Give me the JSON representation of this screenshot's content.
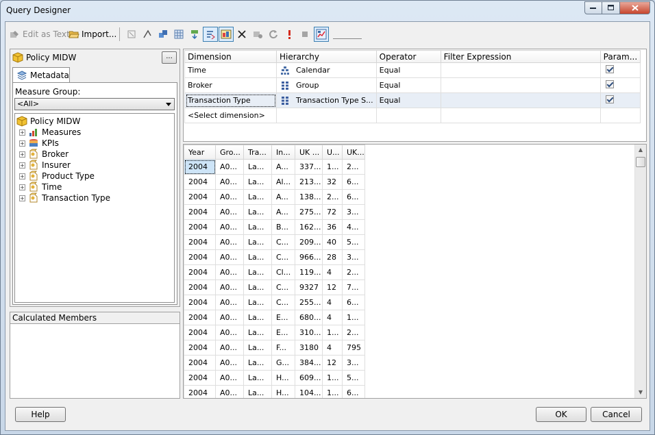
{
  "window": {
    "title": "Query Designer"
  },
  "toolbar": {
    "edit_as_text": "Edit as Text",
    "import": "Import..."
  },
  "cube": {
    "name": "Policy MIDW",
    "browse_button": "..."
  },
  "metadata_tab": {
    "label": "Metadata"
  },
  "measure_group": {
    "label": "Measure Group:",
    "value": "<All>"
  },
  "tree": {
    "root": "Policy MIDW",
    "items": [
      {
        "label": "Measures",
        "icon": "measures-icon"
      },
      {
        "label": "KPIs",
        "icon": "kpi-icon"
      },
      {
        "label": "Broker",
        "icon": "dimension-icon"
      },
      {
        "label": "Insurer",
        "icon": "dimension-icon"
      },
      {
        "label": "Product Type",
        "icon": "dimension-icon"
      },
      {
        "label": "Time",
        "icon": "dimension-icon"
      },
      {
        "label": "Transaction Type",
        "icon": "dimension-icon"
      }
    ]
  },
  "calculated_members": {
    "label": "Calculated Members"
  },
  "filter": {
    "headers": [
      "Dimension",
      "Hierarchy",
      "Operator",
      "Filter Expression",
      "Param..."
    ],
    "rows": [
      {
        "dimension": "Time",
        "hierarchy": "Calendar",
        "operator": "Equal",
        "expression": "",
        "param": true,
        "icon": "hierarchy-icon"
      },
      {
        "dimension": "Broker",
        "hierarchy": "Group",
        "operator": "Equal",
        "expression": "",
        "param": true,
        "icon": "attribute-icon"
      },
      {
        "dimension": "Transaction Type",
        "hierarchy": "Transaction Type S...",
        "operator": "Equal",
        "expression": "",
        "param": true,
        "icon": "attribute-icon"
      }
    ],
    "select_dimension": "<Select dimension>"
  },
  "results": {
    "headers": [
      "Year",
      "Gro...",
      "Tra...",
      "In...",
      "UK ...",
      "U...",
      "UK..."
    ],
    "rows": [
      [
        "2004",
        "A0...",
        "La...",
        "A...",
        "337...",
        "1...",
        "2..."
      ],
      [
        "2004",
        "A0...",
        "La...",
        "Al...",
        "213...",
        "32",
        "6..."
      ],
      [
        "2004",
        "A0...",
        "La...",
        "A...",
        "138...",
        "2...",
        "6..."
      ],
      [
        "2004",
        "A0...",
        "La...",
        "A...",
        "275...",
        "72",
        "3..."
      ],
      [
        "2004",
        "A0...",
        "La...",
        "B...",
        "162...",
        "36",
        "4..."
      ],
      [
        "2004",
        "A0...",
        "La...",
        "C...",
        "209...",
        "40",
        "5..."
      ],
      [
        "2004",
        "A0...",
        "La...",
        "C...",
        "966...",
        "28",
        "3..."
      ],
      [
        "2004",
        "A0...",
        "La...",
        "Cl...",
        "119...",
        "4",
        "2..."
      ],
      [
        "2004",
        "A0...",
        "La...",
        "C...",
        "9327",
        "12",
        "7..."
      ],
      [
        "2004",
        "A0...",
        "La...",
        "C...",
        "255...",
        "4",
        "6..."
      ],
      [
        "2004",
        "A0...",
        "La...",
        "E...",
        "680...",
        "4",
        "1..."
      ],
      [
        "2004",
        "A0...",
        "La...",
        "E...",
        "310...",
        "1...",
        "2..."
      ],
      [
        "2004",
        "A0...",
        "La...",
        "F...",
        "3180",
        "4",
        "795"
      ],
      [
        "2004",
        "A0...",
        "La...",
        "G...",
        "384...",
        "12",
        "3..."
      ],
      [
        "2004",
        "A0...",
        "La...",
        "H...",
        "609...",
        "1...",
        "5..."
      ],
      [
        "2004",
        "A0...",
        "La...",
        "H...",
        "104...",
        "1...",
        "6..."
      ]
    ]
  },
  "buttons": {
    "help": "Help",
    "ok": "OK",
    "cancel": "Cancel"
  }
}
